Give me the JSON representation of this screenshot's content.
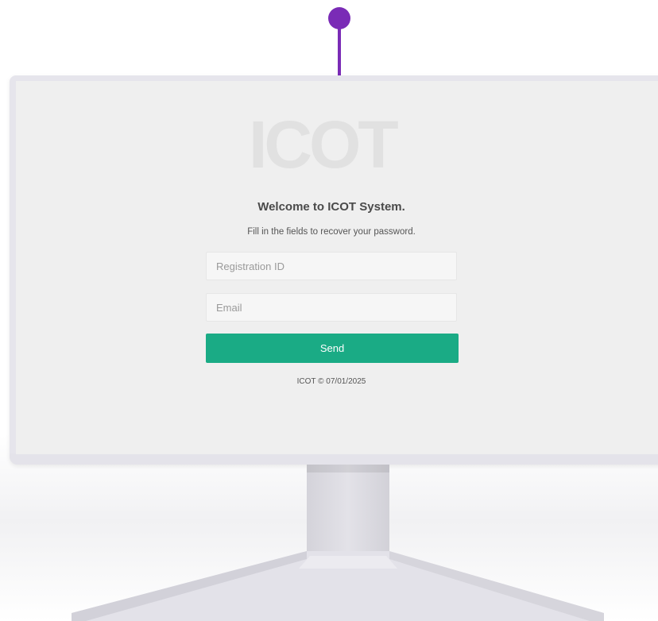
{
  "logo": {
    "text": "ICOT"
  },
  "login": {
    "heading": "Welcome to ICOT System.",
    "subtitle": "Fill in the fields to recover your password.",
    "registration_placeholder": "Registration ID",
    "email_placeholder": "Email",
    "send_label": "Send"
  },
  "footer": {
    "text": "ICOT © 07/01/2025"
  },
  "colors": {
    "accent": "#1aab85",
    "pin": "#7a2bb6",
    "screen_background": "#efefef"
  }
}
